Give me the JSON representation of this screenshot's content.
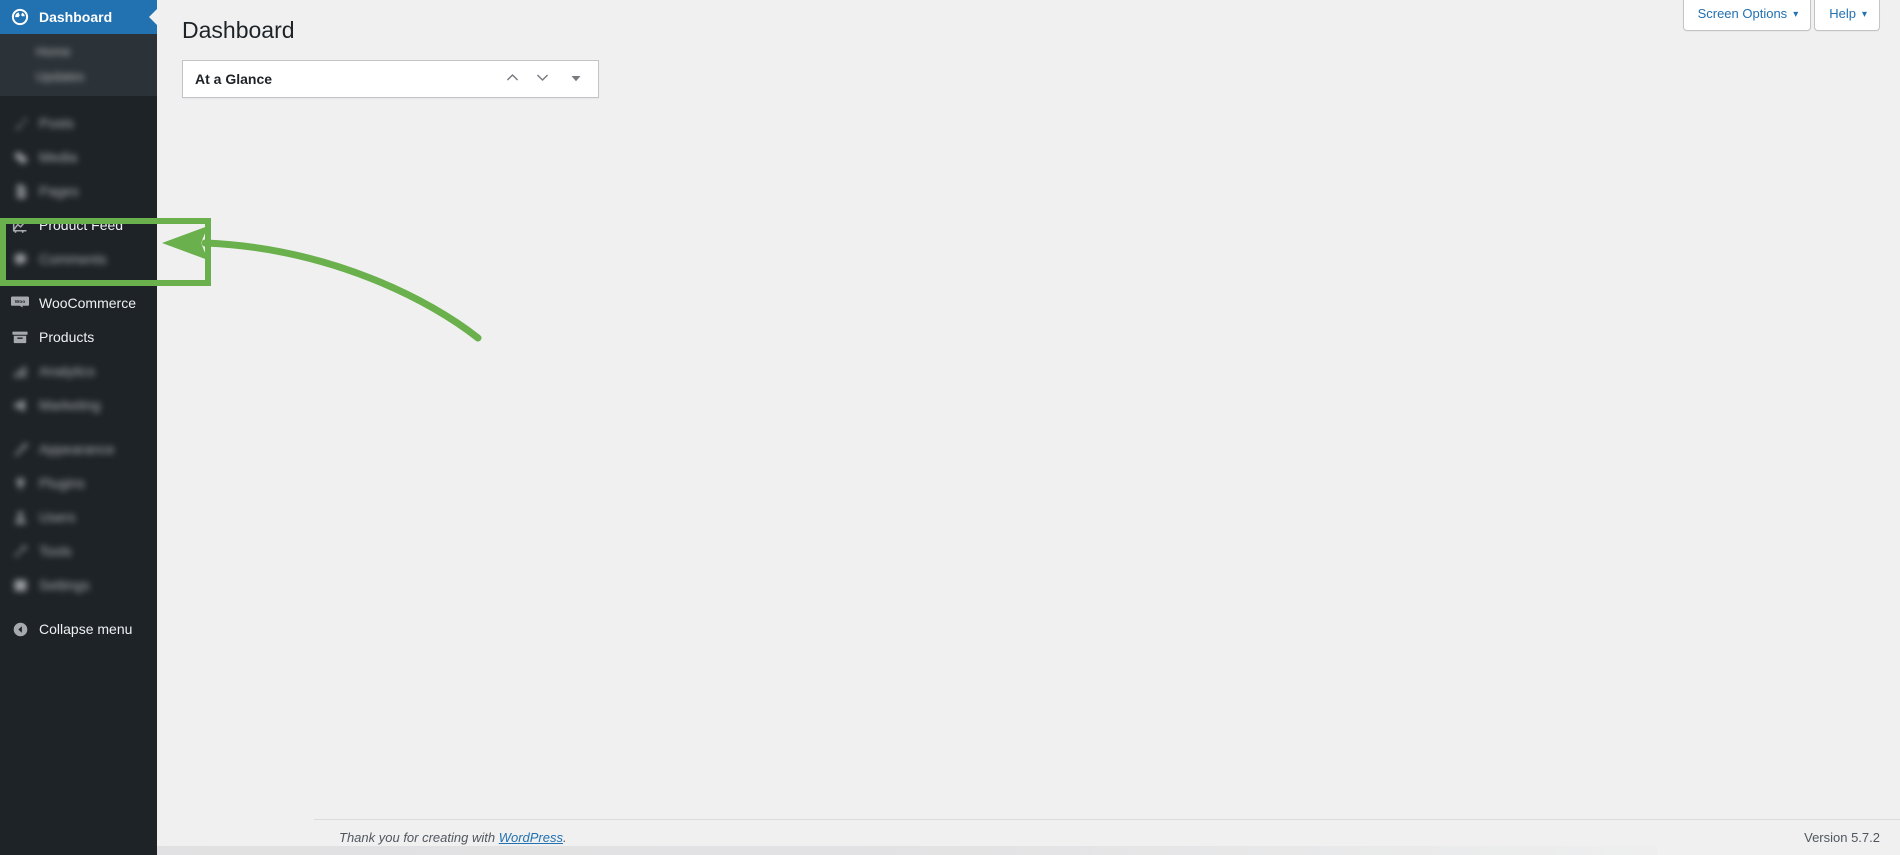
{
  "window": {
    "page_title": "Dashboard"
  },
  "screen_meta": {
    "screen_options_label": "Screen Options",
    "help_label": "Help",
    "caret": "▾"
  },
  "sidebar": {
    "current_item": "Dashboard",
    "items": [
      {
        "label": "Dashboard",
        "icon": "dashboard-icon",
        "state": "current",
        "blurred": false
      },
      {
        "label": "Posts",
        "icon": "pin-icon",
        "state": "normal",
        "blurred": true
      },
      {
        "label": "Media",
        "icon": "media-icon",
        "state": "normal",
        "blurred": true
      },
      {
        "label": "Pages",
        "icon": "page-icon",
        "state": "normal",
        "blurred": true
      },
      {
        "label": "Product Feed",
        "icon": "chart-line-icon",
        "state": "normal",
        "blurred": false
      },
      {
        "label": "Comments",
        "icon": "comment-icon",
        "state": "normal",
        "blurred": true
      },
      {
        "label": "WooCommerce",
        "icon": "woocommerce-icon",
        "state": "normal",
        "blurred": false
      },
      {
        "label": "Products",
        "icon": "products-box-icon",
        "state": "normal",
        "blurred": false
      },
      {
        "label": "Analytics",
        "icon": "bar-chart-icon",
        "state": "normal",
        "blurred": true
      },
      {
        "label": "Marketing",
        "icon": "megaphone-icon",
        "state": "normal",
        "blurred": true
      },
      {
        "label": "Appearance",
        "icon": "paintbrush-icon",
        "state": "normal",
        "blurred": true
      },
      {
        "label": "Plugins",
        "icon": "plug-icon",
        "state": "normal",
        "blurred": true
      },
      {
        "label": "Users",
        "icon": "user-icon",
        "state": "normal",
        "blurred": true
      },
      {
        "label": "Tools",
        "icon": "hammer-icon",
        "state": "normal",
        "blurred": true
      },
      {
        "label": "Settings",
        "icon": "sliders-icon",
        "state": "normal",
        "blurred": true
      }
    ],
    "dashboard_submenu": [
      {
        "label": "Home",
        "blurred": true
      },
      {
        "label": "Updates",
        "blurred": true
      }
    ],
    "collapse_label": "Collapse menu",
    "collapse_icon": "collapse-arrow-icon"
  },
  "main": {
    "widgets": [
      {
        "title": "At a Glance",
        "collapsed": true,
        "actions": {
          "move_up": "order-higher",
          "move_down": "order-lower",
          "toggle": "toggle-panel"
        }
      }
    ]
  },
  "footer": {
    "thanks_prefix": "Thank you for creating with ",
    "wordpress_link": "WordPress",
    "thanks_suffix": ".",
    "version": "Version 5.7.2"
  },
  "annotation": {
    "color": "#6ab04c",
    "highlight_target": "Product Feed",
    "shapes": [
      {
        "kind": "rectangle",
        "target": "product-feed-menu-item"
      },
      {
        "kind": "curved-arrow",
        "points_to": "product-feed-menu-item",
        "direction": "left"
      }
    ]
  },
  "colors": {
    "sidebar_bg": "#1d2327",
    "sidebar_submenu_bg": "#2c3338",
    "current_item_bg": "#2271b1",
    "content_bg": "#f0f0f1",
    "link": "#2271b1",
    "annotation_green": "#6ab04c"
  }
}
